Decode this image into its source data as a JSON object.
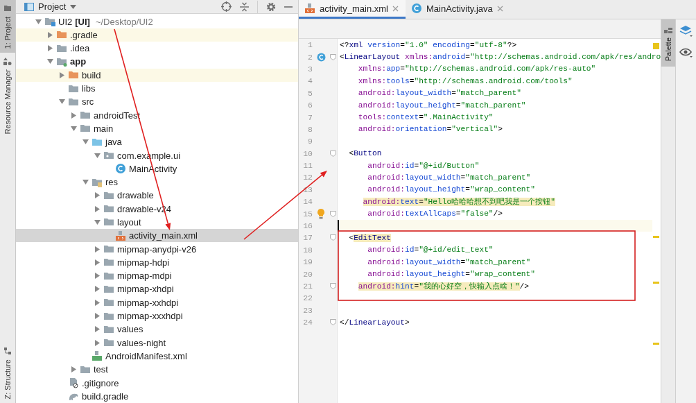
{
  "tool_strip": [
    {
      "label": "1: Project",
      "selected": true
    },
    {
      "label": "Resource Manager",
      "selected": false
    },
    {
      "label": "Z: Structure",
      "selected": false
    }
  ],
  "project_panel": {
    "title": "Project",
    "tree": [
      {
        "name": "UI2",
        "bold_part": "[UI]",
        "path": "~/Desktop/UI2",
        "kind": "project",
        "expanded": true,
        "selected": false,
        "excluded": false,
        "children": [
          {
            "name": ".gradle",
            "kind": "folder",
            "expanded": false,
            "selected": false,
            "excluded": true
          },
          {
            "name": ".idea",
            "kind": "folder",
            "expanded": false,
            "selected": false,
            "excluded": false
          },
          {
            "name": "app",
            "kind": "module",
            "expanded": true,
            "selected": false,
            "excluded": false,
            "children": [
              {
                "name": "build",
                "kind": "folder",
                "expanded": false,
                "selected": false,
                "excluded": true
              },
              {
                "name": "libs",
                "kind": "folder",
                "selected": false,
                "excluded": false
              },
              {
                "name": "src",
                "kind": "folder",
                "expanded": true,
                "selected": false,
                "excluded": false,
                "children": [
                  {
                    "name": "androidTest",
                    "kind": "folder",
                    "expanded": false,
                    "selected": false,
                    "excluded": false
                  },
                  {
                    "name": "main",
                    "kind": "folder",
                    "expanded": true,
                    "selected": false,
                    "excluded": false,
                    "children": [
                      {
                        "name": "java",
                        "kind": "source",
                        "expanded": true,
                        "selected": false,
                        "excluded": false,
                        "children": [
                          {
                            "name": "com.example.ui",
                            "kind": "package",
                            "expanded": true,
                            "selected": false,
                            "excluded": false,
                            "children": [
                              {
                                "name": "MainActivity",
                                "kind": "class",
                                "selected": false
                              }
                            ]
                          }
                        ]
                      },
                      {
                        "name": "res",
                        "kind": "res",
                        "expanded": true,
                        "selected": false,
                        "excluded": false,
                        "children": [
                          {
                            "name": "drawable",
                            "kind": "folder",
                            "expanded": false,
                            "selected": false,
                            "excluded": false
                          },
                          {
                            "name": "drawable-v24",
                            "kind": "folder",
                            "expanded": false,
                            "selected": false,
                            "excluded": false
                          },
                          {
                            "name": "layout",
                            "kind": "folder",
                            "expanded": true,
                            "selected": false,
                            "excluded": false,
                            "children": [
                              {
                                "name": "activity_main.xml",
                                "kind": "layout",
                                "selected": true
                              }
                            ]
                          },
                          {
                            "name": "mipmap-anydpi-v26",
                            "kind": "folder",
                            "expanded": false,
                            "selected": false,
                            "excluded": false
                          },
                          {
                            "name": "mipmap-hdpi",
                            "kind": "folder",
                            "expanded": false,
                            "selected": false,
                            "excluded": false
                          },
                          {
                            "name": "mipmap-mdpi",
                            "kind": "folder",
                            "expanded": false,
                            "selected": false,
                            "excluded": false
                          },
                          {
                            "name": "mipmap-xhdpi",
                            "kind": "folder",
                            "expanded": false,
                            "selected": false,
                            "excluded": false
                          },
                          {
                            "name": "mipmap-xxhdpi",
                            "kind": "folder",
                            "expanded": false,
                            "selected": false,
                            "excluded": false
                          },
                          {
                            "name": "mipmap-xxxhdpi",
                            "kind": "folder",
                            "expanded": false,
                            "selected": false,
                            "excluded": false
                          },
                          {
                            "name": "values",
                            "kind": "folder",
                            "expanded": false,
                            "selected": false,
                            "excluded": false
                          },
                          {
                            "name": "values-night",
                            "kind": "folder",
                            "expanded": false,
                            "selected": false,
                            "excluded": false
                          }
                        ]
                      },
                      {
                        "name": "AndroidManifest.xml",
                        "kind": "manifest",
                        "selected": false
                      }
                    ]
                  },
                  {
                    "name": "test",
                    "kind": "folder",
                    "expanded": false,
                    "selected": false,
                    "excluded": false
                  }
                ]
              },
              {
                "name": ".gitignore",
                "kind": "gitignore",
                "selected": false
              },
              {
                "name": "build.gradle",
                "kind": "gradle",
                "selected": false
              }
            ]
          }
        ]
      }
    ]
  },
  "editor_tabs": [
    {
      "label": "activity_main.xml",
      "kind": "layout",
      "selected": true
    },
    {
      "label": "MainActivity.java",
      "kind": "class",
      "selected": false
    }
  ],
  "code_lines": [
    {
      "number": "1",
      "current": false,
      "fold": false,
      "tokens": [
        {
          "kind": "punct",
          "text": "<?"
        },
        {
          "kind": "tag",
          "text": "xml "
        },
        {
          "kind": "attr",
          "text": "version"
        },
        {
          "kind": "punct",
          "text": "="
        },
        {
          "kind": "value",
          "text": "\"1.0\" "
        },
        {
          "kind": "attr",
          "text": "encoding"
        },
        {
          "kind": "punct",
          "text": "="
        },
        {
          "kind": "value",
          "text": "\"utf-8\""
        },
        {
          "kind": "punct",
          "text": "?>"
        }
      ]
    },
    {
      "number": "2",
      "current": false,
      "fold": true,
      "gutter": {
        "kind": "class"
      },
      "tokens": [
        {
          "kind": "punct",
          "text": "<"
        },
        {
          "kind": "tag",
          "text": "LinearLayout "
        },
        {
          "kind": "ns",
          "text": "xmlns:"
        },
        {
          "kind": "attr",
          "text": "android"
        },
        {
          "kind": "punct",
          "text": "="
        },
        {
          "kind": "value",
          "text": "\"http://schemas.android.com/apk/res/andro"
        }
      ]
    },
    {
      "number": "3",
      "current": false,
      "fold": false,
      "tokens": [
        {
          "kind": "ns",
          "text": "    xmlns:"
        },
        {
          "kind": "attr",
          "text": "app"
        },
        {
          "kind": "punct",
          "text": "="
        },
        {
          "kind": "value",
          "text": "\"http://schemas.android.com/apk/res-auto\""
        }
      ]
    },
    {
      "number": "4",
      "current": false,
      "fold": false,
      "tokens": [
        {
          "kind": "ns",
          "text": "    xmlns:"
        },
        {
          "kind": "attr",
          "text": "tools"
        },
        {
          "kind": "punct",
          "text": "="
        },
        {
          "kind": "value",
          "text": "\"http://schemas.android.com/tools\""
        }
      ]
    },
    {
      "number": "5",
      "current": false,
      "fold": false,
      "tokens": [
        {
          "kind": "ns",
          "text": "    android:"
        },
        {
          "kind": "attr",
          "text": "layout_width"
        },
        {
          "kind": "punct",
          "text": "="
        },
        {
          "kind": "value",
          "text": "\"match_parent\""
        }
      ]
    },
    {
      "number": "6",
      "current": false,
      "fold": false,
      "tokens": [
        {
          "kind": "ns",
          "text": "    android:"
        },
        {
          "kind": "attr",
          "text": "layout_height"
        },
        {
          "kind": "punct",
          "text": "="
        },
        {
          "kind": "value",
          "text": "\"match_parent\""
        }
      ]
    },
    {
      "number": "7",
      "current": false,
      "fold": false,
      "tokens": [
        {
          "kind": "ns",
          "text": "    tools:"
        },
        {
          "kind": "attr",
          "text": "context"
        },
        {
          "kind": "punct",
          "text": "="
        },
        {
          "kind": "value",
          "text": "\".MainActivity\""
        }
      ]
    },
    {
      "number": "8",
      "current": false,
      "fold": false,
      "tokens": [
        {
          "kind": "ns",
          "text": "    android:"
        },
        {
          "kind": "attr",
          "text": "orientation"
        },
        {
          "kind": "punct",
          "text": "="
        },
        {
          "kind": "value",
          "text": "\"vertical\""
        },
        {
          "kind": "punct",
          "text": ">"
        }
      ]
    },
    {
      "number": "9",
      "current": false,
      "fold": false
    },
    {
      "number": "10",
      "current": false,
      "fold": true,
      "tokens": [
        {
          "kind": "punct",
          "text": "  <"
        },
        {
          "kind": "tag",
          "text": "Button"
        }
      ]
    },
    {
      "number": "11",
      "current": false,
      "fold": false,
      "tokens": [
        {
          "kind": "ns",
          "text": "      android:"
        },
        {
          "kind": "attr",
          "text": "id"
        },
        {
          "kind": "punct",
          "text": "="
        },
        {
          "kind": "value",
          "text": "\"@+id/Button\""
        }
      ]
    },
    {
      "number": "12",
      "current": false,
      "fold": false,
      "tokens": [
        {
          "kind": "ns",
          "text": "      android:"
        },
        {
          "kind": "attr",
          "text": "layout_width"
        },
        {
          "kind": "punct",
          "text": "="
        },
        {
          "kind": "value",
          "text": "\"match_parent\""
        }
      ]
    },
    {
      "number": "13",
      "current": false,
      "fold": false,
      "tokens": [
        {
          "kind": "ns",
          "text": "      android:"
        },
        {
          "kind": "attr",
          "text": "layout_height"
        },
        {
          "kind": "punct",
          "text": "="
        },
        {
          "kind": "value",
          "text": "\"wrap_content\""
        }
      ]
    },
    {
      "number": "14",
      "current": false,
      "fold": false,
      "tokens": [
        {
          "kind": "ns",
          "text": "     android:",
          "warning": true
        },
        {
          "kind": "attr",
          "text": "text",
          "warning": true
        },
        {
          "kind": "punct",
          "text": "=",
          "warning": true
        },
        {
          "kind": "value",
          "text": "\"Hello哈哈哈想不到吧我是一个按钮\"",
          "warning": true
        }
      ]
    },
    {
      "number": "15",
      "current": false,
      "fold": true,
      "gutter": {
        "kind": "bulb"
      },
      "tokens": [
        {
          "kind": "ns",
          "text": "      android:"
        },
        {
          "kind": "attr",
          "text": "textAllCaps"
        },
        {
          "kind": "punct",
          "text": "="
        },
        {
          "kind": "value",
          "text": "\"false\""
        },
        {
          "kind": "punct",
          "text": "/>"
        }
      ]
    },
    {
      "number": "16",
      "current": true,
      "fold": false
    },
    {
      "number": "17",
      "current": false,
      "fold": true,
      "tokens": [
        {
          "kind": "punct",
          "text": "  <"
        },
        {
          "kind": "tag",
          "text": "EditText",
          "warning": true
        }
      ]
    },
    {
      "number": "18",
      "current": false,
      "fold": false,
      "tokens": [
        {
          "kind": "ns",
          "text": "      android:"
        },
        {
          "kind": "attr",
          "text": "id"
        },
        {
          "kind": "punct",
          "text": "="
        },
        {
          "kind": "value",
          "text": "\"@+id/edit_text\""
        }
      ]
    },
    {
      "number": "19",
      "current": false,
      "fold": false,
      "tokens": [
        {
          "kind": "ns",
          "text": "      android:"
        },
        {
          "kind": "attr",
          "text": "layout_width"
        },
        {
          "kind": "punct",
          "text": "="
        },
        {
          "kind": "value",
          "text": "\"match_parent\""
        }
      ]
    },
    {
      "number": "20",
      "current": false,
      "fold": false,
      "tokens": [
        {
          "kind": "ns",
          "text": "      android:"
        },
        {
          "kind": "attr",
          "text": "layout_height"
        },
        {
          "kind": "punct",
          "text": "="
        },
        {
          "kind": "value",
          "text": "\"wrap_content\""
        }
      ]
    },
    {
      "number": "21",
      "current": false,
      "fold": true,
      "tokens": [
        {
          "kind": "ns",
          "text": "    android:",
          "warning": true
        },
        {
          "kind": "attr",
          "text": "hint",
          "warning": true
        },
        {
          "kind": "punct",
          "text": "=",
          "warning": true
        },
        {
          "kind": "value",
          "text": "\"我的心好空，快输入点啥！\"",
          "warning": true
        },
        {
          "kind": "punct",
          "text": "/>"
        }
      ]
    },
    {
      "number": "22",
      "current": false,
      "fold": false
    },
    {
      "number": "23",
      "current": false,
      "fold": false
    },
    {
      "number": "24",
      "current": false,
      "fold": true,
      "tokens": [
        {
          "kind": "punct",
          "text": "</"
        },
        {
          "kind": "tag",
          "text": "LinearLayout"
        },
        {
          "kind": "punct",
          "text": ">"
        }
      ]
    }
  ],
  "side_tabs": [
    {
      "label": "Palette",
      "selected": true
    }
  ],
  "annotations": [
    {
      "kind": "arrow"
    },
    {
      "kind": "arrow"
    },
    {
      "kind": "box"
    }
  ]
}
